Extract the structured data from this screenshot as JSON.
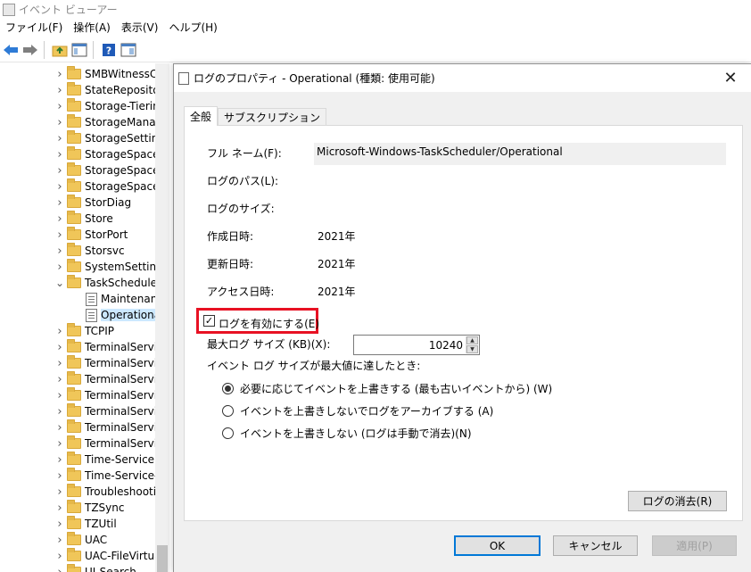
{
  "window": {
    "title": "イベント ビューアー"
  },
  "menubar": [
    "ファイル(F)",
    "操作(A)",
    "表示(V)",
    "ヘルプ(H)"
  ],
  "toolbar": {
    "icons": [
      "back-arrow-icon",
      "forward-arrow-icon",
      "folder-up-icon",
      "show-hide-console-tree-icon",
      "help-icon",
      "action-pane-icon"
    ]
  },
  "tree": {
    "items": [
      {
        "label": "SMBWitnessCl",
        "type": "folder",
        "expanded": false
      },
      {
        "label": "StateRepositor",
        "type": "folder",
        "expanded": false
      },
      {
        "label": "Storage-Tiering",
        "type": "folder",
        "expanded": false
      },
      {
        "label": "StorageManag",
        "type": "folder",
        "expanded": false
      },
      {
        "label": "StorageSetting",
        "type": "folder",
        "expanded": false
      },
      {
        "label": "StorageSpaces",
        "type": "folder",
        "expanded": false
      },
      {
        "label": "StorageSpaces",
        "type": "folder",
        "expanded": false
      },
      {
        "label": "StorageSpaces",
        "type": "folder",
        "expanded": false
      },
      {
        "label": "StorDiag",
        "type": "folder",
        "expanded": false
      },
      {
        "label": "Store",
        "type": "folder",
        "expanded": false
      },
      {
        "label": "StorPort",
        "type": "folder",
        "expanded": false
      },
      {
        "label": "Storsvc",
        "type": "folder",
        "expanded": false
      },
      {
        "label": "SystemSettings",
        "type": "folder",
        "expanded": false
      },
      {
        "label": "TaskScheduler",
        "type": "folder",
        "expanded": true
      },
      {
        "label": "Maintenan",
        "type": "log",
        "child": true
      },
      {
        "label": "Operationa",
        "type": "log",
        "child": true,
        "selected": true
      },
      {
        "label": "TCPIP",
        "type": "folder",
        "expanded": false
      },
      {
        "label": "TerminalServic",
        "type": "folder",
        "expanded": false
      },
      {
        "label": "TerminalServic",
        "type": "folder",
        "expanded": false
      },
      {
        "label": "TerminalServic",
        "type": "folder",
        "expanded": false
      },
      {
        "label": "TerminalServic",
        "type": "folder",
        "expanded": false
      },
      {
        "label": "TerminalServic",
        "type": "folder",
        "expanded": false
      },
      {
        "label": "TerminalServic",
        "type": "folder",
        "expanded": false
      },
      {
        "label": "TerminalServic",
        "type": "folder",
        "expanded": false
      },
      {
        "label": "Time-Service",
        "type": "folder",
        "expanded": false
      },
      {
        "label": "Time-Service-P",
        "type": "folder",
        "expanded": false
      },
      {
        "label": "Troubleshootin",
        "type": "folder",
        "expanded": false
      },
      {
        "label": "TZSync",
        "type": "folder",
        "expanded": false
      },
      {
        "label": "TZUtil",
        "type": "folder",
        "expanded": false
      },
      {
        "label": "UAC",
        "type": "folder",
        "expanded": false
      },
      {
        "label": "UAC-FileVirtua",
        "type": "folder",
        "expanded": false
      },
      {
        "label": "UI-Search",
        "type": "folder",
        "expanded": false
      }
    ]
  },
  "dialog": {
    "title": "ログのプロパティ - Operational (種類: 使用可能)",
    "close_glyph": "✕",
    "tabs": [
      "全般",
      "サブスクリプション"
    ],
    "active_tab": 0,
    "props": {
      "fullname_label": "フル ネーム(F):",
      "fullname_value": "Microsoft-Windows-TaskScheduler/Operational",
      "path_label": "ログのパス(L):",
      "size_label": "ログのサイズ:",
      "created_label": "作成日時:",
      "created_value": "2021年",
      "modified_label": "更新日時:",
      "modified_value": "2021年",
      "accessed_label": "アクセス日時:",
      "accessed_value": "2021年"
    },
    "enable_log": {
      "label": "ログを有効にする(E)",
      "checked": true,
      "check_glyph": "✓"
    },
    "max_size": {
      "label": "最大ログ サイズ (KB)(X):",
      "value": "10240"
    },
    "when_full": {
      "label": "イベント ログ サイズが最大値に達したとき:",
      "options": [
        {
          "label": "必要に応じてイベントを上書きする (最も古いイベントから) (W)",
          "checked": true
        },
        {
          "label": "イベントを上書きしないでログをアーカイブする (A)",
          "checked": false
        },
        {
          "label": "イベントを上書きしない (ログは手動で消去)(N)",
          "checked": false
        }
      ]
    },
    "clear_log_label": "ログの消去(R)",
    "ok_label": "OK",
    "cancel_label": "キャンセル",
    "apply_label": "適用(P)"
  },
  "colors": {
    "highlight_border": "#e81123",
    "default_button_border": "#0078d7",
    "folder": "#f0c659"
  }
}
